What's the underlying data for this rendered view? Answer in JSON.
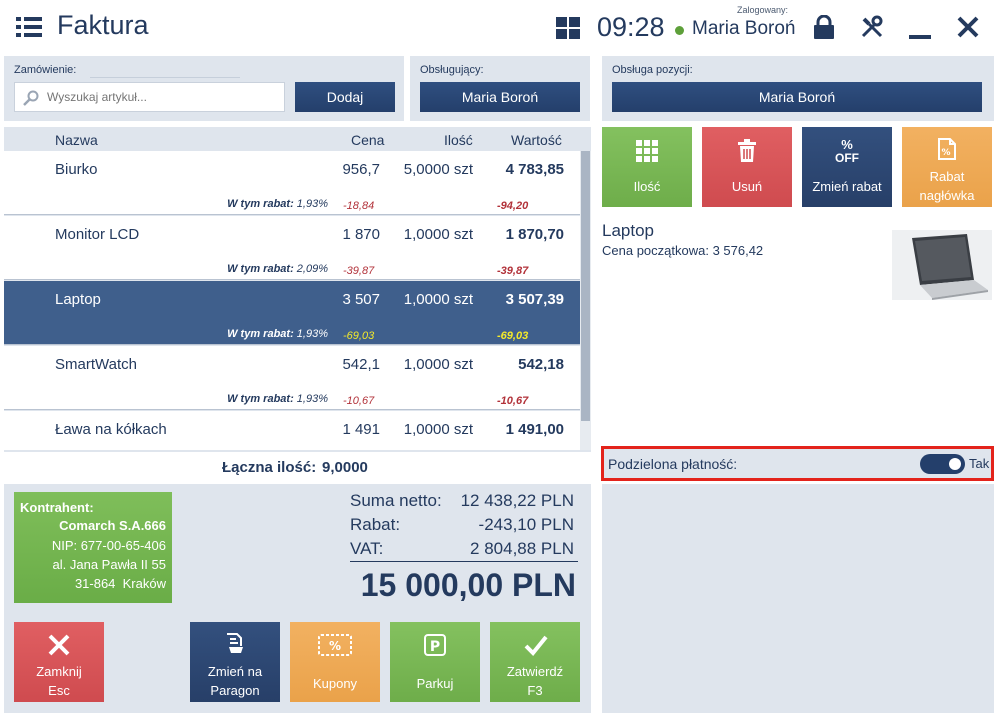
{
  "header": {
    "title": "Faktura",
    "time": "09:28",
    "logged_label": "Zalogowany:",
    "user": "Maria Boroń"
  },
  "order": {
    "label": "Zamówienie:",
    "search_placeholder": "Wyszukaj artykuł...",
    "add_label": "Dodaj"
  },
  "handler": {
    "label": "Obsługujący:",
    "name": "Maria Boroń"
  },
  "position_handler": {
    "label": "Obsługa pozycji:",
    "name": "Maria Boroń"
  },
  "table": {
    "columns": {
      "name": "Nazwa",
      "price": "Cena",
      "qty": "Ilość",
      "value": "Wartość"
    },
    "discount_label": "W tym rabat:",
    "rows": [
      {
        "name": "Biurko",
        "price": "956,7",
        "qty": "5,0000 szt",
        "value": "4 783,85",
        "disc_pct": "1,93%",
        "disc_price": "-18,84",
        "disc_value": "-94,20"
      },
      {
        "name": "Monitor LCD",
        "price": "1 870",
        "qty": "1,0000 szt",
        "value": "1 870,70",
        "disc_pct": "2,09%",
        "disc_price": "-39,87",
        "disc_value": "-39,87"
      },
      {
        "name": "Laptop",
        "price": "3 507",
        "qty": "1,0000 szt",
        "value": "3 507,39",
        "disc_pct": "1,93%",
        "disc_price": "-69,03",
        "disc_value": "-69,03"
      },
      {
        "name": "SmartWatch",
        "price": "542,1",
        "qty": "1,0000 szt",
        "value": "542,18",
        "disc_pct": "1,93%",
        "disc_price": "-10,67",
        "disc_value": "-10,67"
      },
      {
        "name": "Ława na kółkach",
        "price": "1 491",
        "qty": "1,0000 szt",
        "value": "1 491,00"
      }
    ]
  },
  "total_qty": {
    "label": "Łączna ilość:",
    "value": "9,0000"
  },
  "contractor": {
    "title": "Kontrahent:",
    "name": "Comarch S.A.666",
    "nip": "NIP: 677-00-65-406",
    "street": "al. Jana Pawła II 55",
    "city": "31-864  Kraków"
  },
  "sums": {
    "net_label": "Suma netto:",
    "net_value": "12 438,22 PLN",
    "discount_label": "Rabat:",
    "discount_value": "-243,10 PLN",
    "vat_label": "VAT:",
    "vat_value": "2 804,88 PLN",
    "total": "15 000,00 PLN"
  },
  "bottom_buttons": {
    "close_line1": "Zamknij",
    "close_line2": "Esc",
    "receipt_line1": "Zmień na",
    "receipt_line2": "Paragon",
    "coupons": "Kupony",
    "park": "Parkuj",
    "confirm_line1": "Zatwierdź",
    "confirm_line2": "F3"
  },
  "tiles": {
    "qty": "Ilość",
    "delete": "Usuń",
    "change_discount": "Zmień rabat",
    "off_percent": "%",
    "off_text": "OFF",
    "header_discount_line1": "Rabat",
    "header_discount_line2": "nagłówka"
  },
  "product": {
    "name": "Laptop",
    "initial_price": "Cena początkowa: 3 576,42"
  },
  "split_payment": {
    "label": "Podzielona płatność:",
    "state": "Tak"
  },
  "colors": {
    "navy": "#243f6b",
    "panel": "#dfe5ed",
    "green": "#6ead4a",
    "red": "#cf4b4f",
    "orange": "#eaa24a",
    "highlight": "#e3231b",
    "discount_text": "#b2323a",
    "selected_discount": "#f4ea2a"
  }
}
